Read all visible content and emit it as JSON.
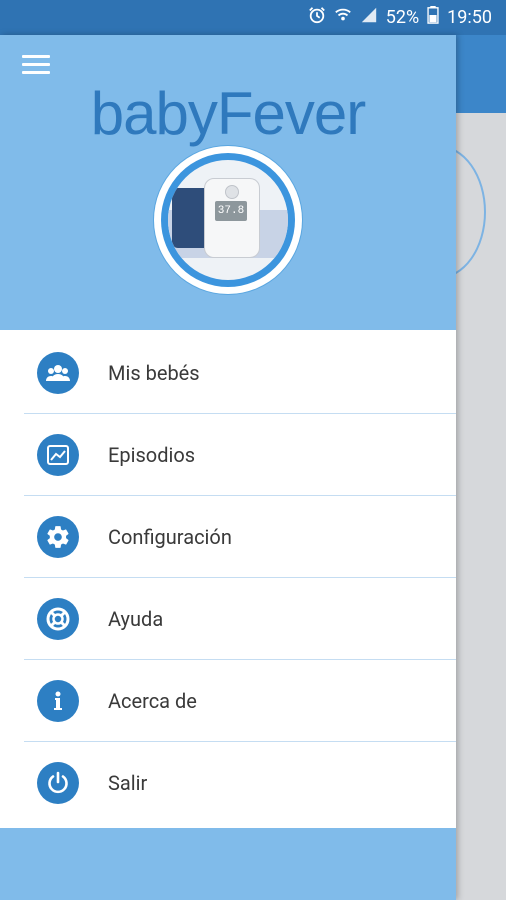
{
  "status_bar": {
    "battery_percent": "52%",
    "time": "19:50",
    "icons": [
      "alarm-icon",
      "wifi-icon",
      "signal-icon",
      "battery-icon"
    ]
  },
  "app": {
    "name": "babyFever",
    "device_display": "37.8"
  },
  "menu": {
    "items": [
      {
        "label": "Mis bebés",
        "icon": "group-icon"
      },
      {
        "label": "Episodios",
        "icon": "chart-icon"
      },
      {
        "label": "Configuración",
        "icon": "gear-icon"
      },
      {
        "label": "Ayuda",
        "icon": "lifebuoy-icon"
      },
      {
        "label": "Acerca de",
        "icon": "info-icon"
      },
      {
        "label": "Salir",
        "icon": "power-icon"
      }
    ]
  },
  "colors": {
    "accent": "#2d7fc3",
    "header": "#80bbea",
    "status_bar": "#2f73b3"
  }
}
